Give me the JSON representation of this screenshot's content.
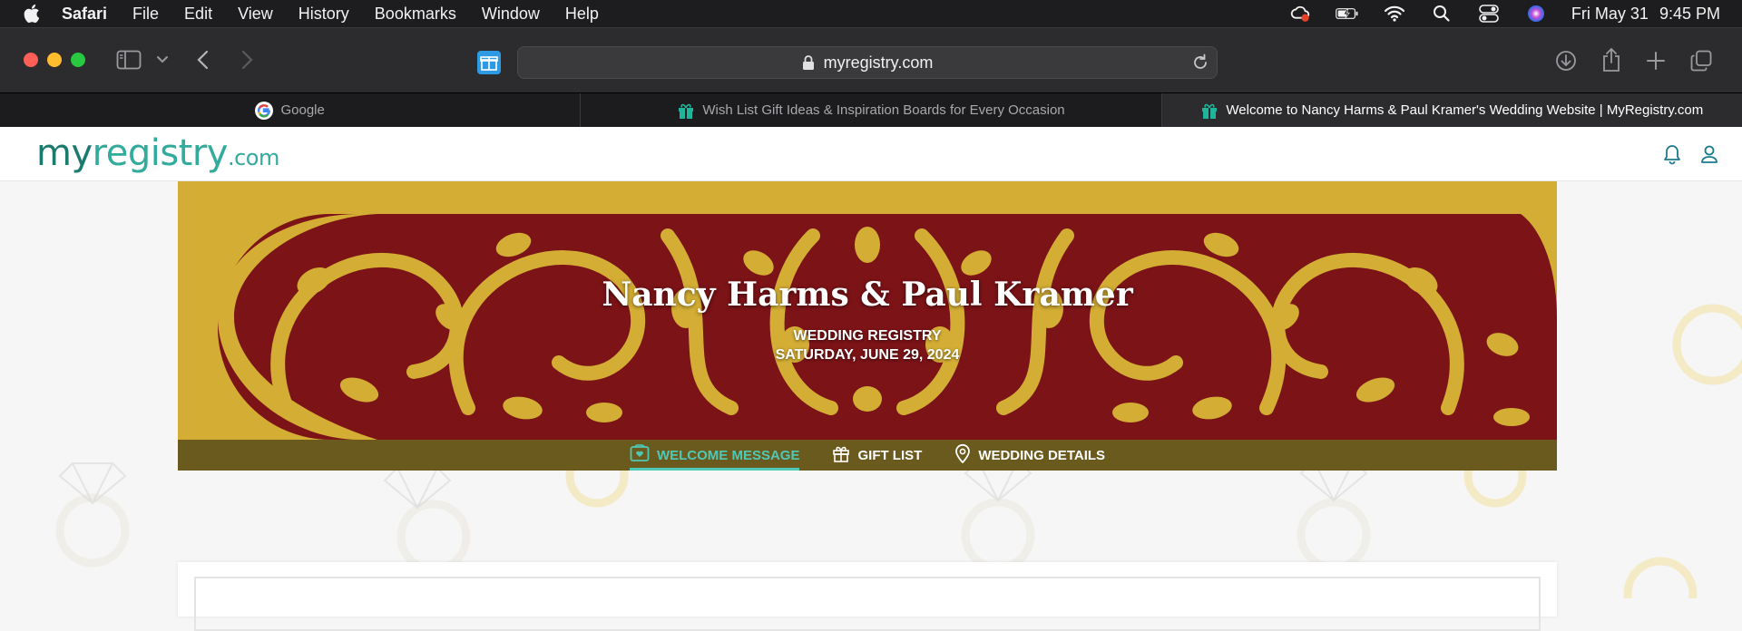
{
  "menubar": {
    "app": "Safari",
    "items": [
      "File",
      "Edit",
      "View",
      "History",
      "Bookmarks",
      "Window",
      "Help"
    ],
    "date": "Fri May 31",
    "time": "9:45 PM",
    "icons": [
      "apple-icon",
      "creative-cloud-icon",
      "battery-icon",
      "wifi-icon",
      "spotlight-icon",
      "control-center-icon",
      "siri-icon"
    ]
  },
  "toolbar": {
    "url": "myregistry.com",
    "icons": [
      "sidebar-icon",
      "chevron-down-icon",
      "back-icon",
      "forward-icon",
      "gift-extension-icon",
      "lock-icon",
      "reload-icon",
      "download-icon",
      "share-icon",
      "new-tab-icon",
      "tab-overview-icon"
    ]
  },
  "tabs": [
    {
      "title": "Google",
      "favicon": "google-icon"
    },
    {
      "title": "Wish List Gift Ideas & Inspiration Boards for Every Occasion",
      "favicon": "gift-icon"
    },
    {
      "title": "Welcome to Nancy Harms & Paul Kramer's Wedding Website | MyRegistry.com",
      "favicon": "gift-icon"
    }
  ],
  "site": {
    "logo_my": "my",
    "logo_registry": "registry",
    "logo_dotcom": ".com"
  },
  "banner": {
    "couple": "Nancy Harms & Paul Kramer",
    "subtitle": "WEDDING REGISTRY",
    "date": "SATURDAY, JUNE 29, 2024"
  },
  "nav": {
    "welcome": "WELCOME MESSAGE",
    "gifts": "GIFT LIST",
    "details": "WEDDING DETAILS"
  },
  "colors": {
    "banner_gold": "#d3ad34",
    "banner_red": "#7b1317",
    "nav_strip": "#6b5a1e",
    "accent_teal": "#4fc9b7",
    "logo_dark": "#1b7a6e",
    "logo_light": "#33ab9c"
  }
}
